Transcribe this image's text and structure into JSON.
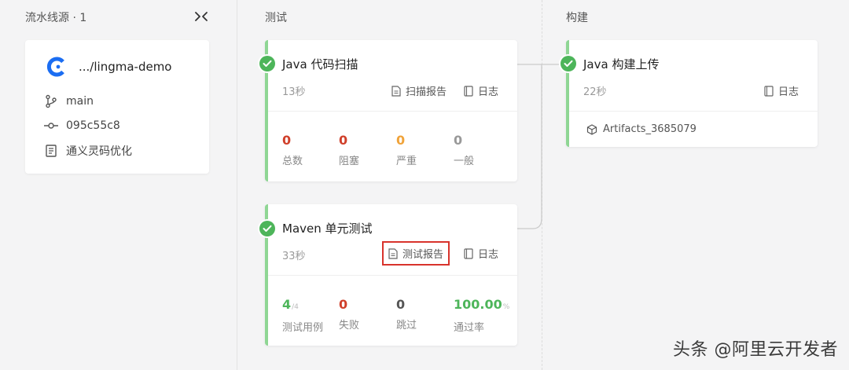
{
  "columns": {
    "source_label": "流水线源 · 1",
    "test_label": "测试",
    "build_label": "构建"
  },
  "source": {
    "repo": ".../lingma-demo",
    "branch": "main",
    "commit": "095c55c8",
    "message": "通义灵码优化"
  },
  "jobs": {
    "scan": {
      "title": "Java 代码扫描",
      "duration": "13秒",
      "report_label": "扫描报告",
      "log_label": "日志",
      "stats": [
        {
          "value": "0",
          "label": "总数",
          "color": "#d0402b"
        },
        {
          "value": "0",
          "label": "阻塞",
          "color": "#d0402b"
        },
        {
          "value": "0",
          "label": "严重",
          "color": "#f0a33a"
        },
        {
          "value": "0",
          "label": "一般",
          "color": "#999999"
        }
      ]
    },
    "maven": {
      "title": "Maven 单元测试",
      "duration": "33秒",
      "report_label": "测试报告",
      "log_label": "日志",
      "stats": [
        {
          "value": "4",
          "suffix": "/4",
          "label": "测试用例",
          "color": "#4db55a"
        },
        {
          "value": "0",
          "label": "失败",
          "color": "#d0402b"
        },
        {
          "value": "0",
          "label": "跳过",
          "color": "#555555"
        },
        {
          "value": "100.00",
          "suffix": "%",
          "label": "通过率",
          "color": "#4db55a"
        }
      ]
    },
    "build": {
      "title": "Java 构建上传",
      "duration": "22秒",
      "log_label": "日志",
      "artifact": "Artifacts_3685079"
    }
  },
  "watermark": "头条 @阿里云开发者",
  "colors": {
    "success": "#4db55a",
    "accent_border": "#8fd694",
    "highlight_box": "#d8332c",
    "logo_blue": "#1b6df2"
  }
}
